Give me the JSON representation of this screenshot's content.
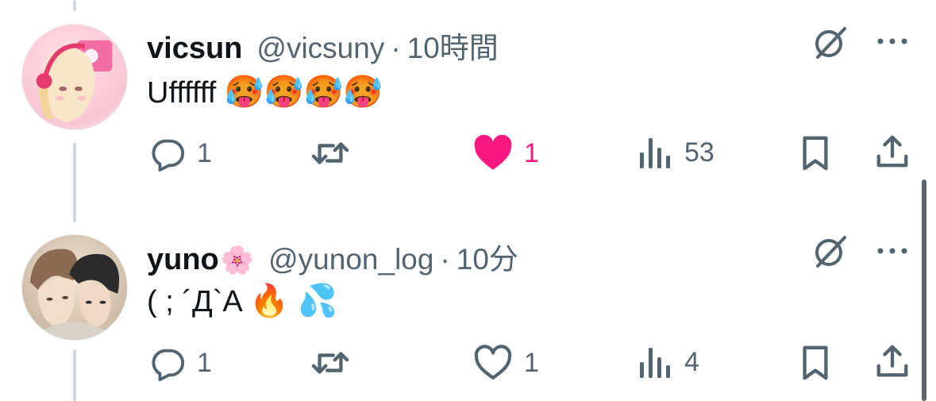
{
  "tweets": [
    {
      "name": "vicsun",
      "name_emoji": "",
      "handle": "@vicsuny",
      "separator": "·",
      "time": "10時間",
      "text": "Uffffff",
      "emojis": "🥵🥵🥵🥵",
      "actions": {
        "reply_count": "1",
        "retweet_count": "",
        "like_count": "1",
        "liked": true,
        "views_count": "53"
      }
    },
    {
      "name": "yuno",
      "name_emoji": "🌸",
      "handle": "@yunon_log",
      "separator": "·",
      "time": "10分",
      "text": "( ; ´Д`A",
      "emojis": "🔥 💦",
      "actions": {
        "reply_count": "1",
        "retweet_count": "",
        "like_count": "1",
        "liked": false,
        "views_count": "4"
      }
    }
  ],
  "colors": {
    "icon_gray": "#536471",
    "like_pink": "#f91880",
    "text": "#0f1419",
    "thread_line": "#cfd9de"
  }
}
